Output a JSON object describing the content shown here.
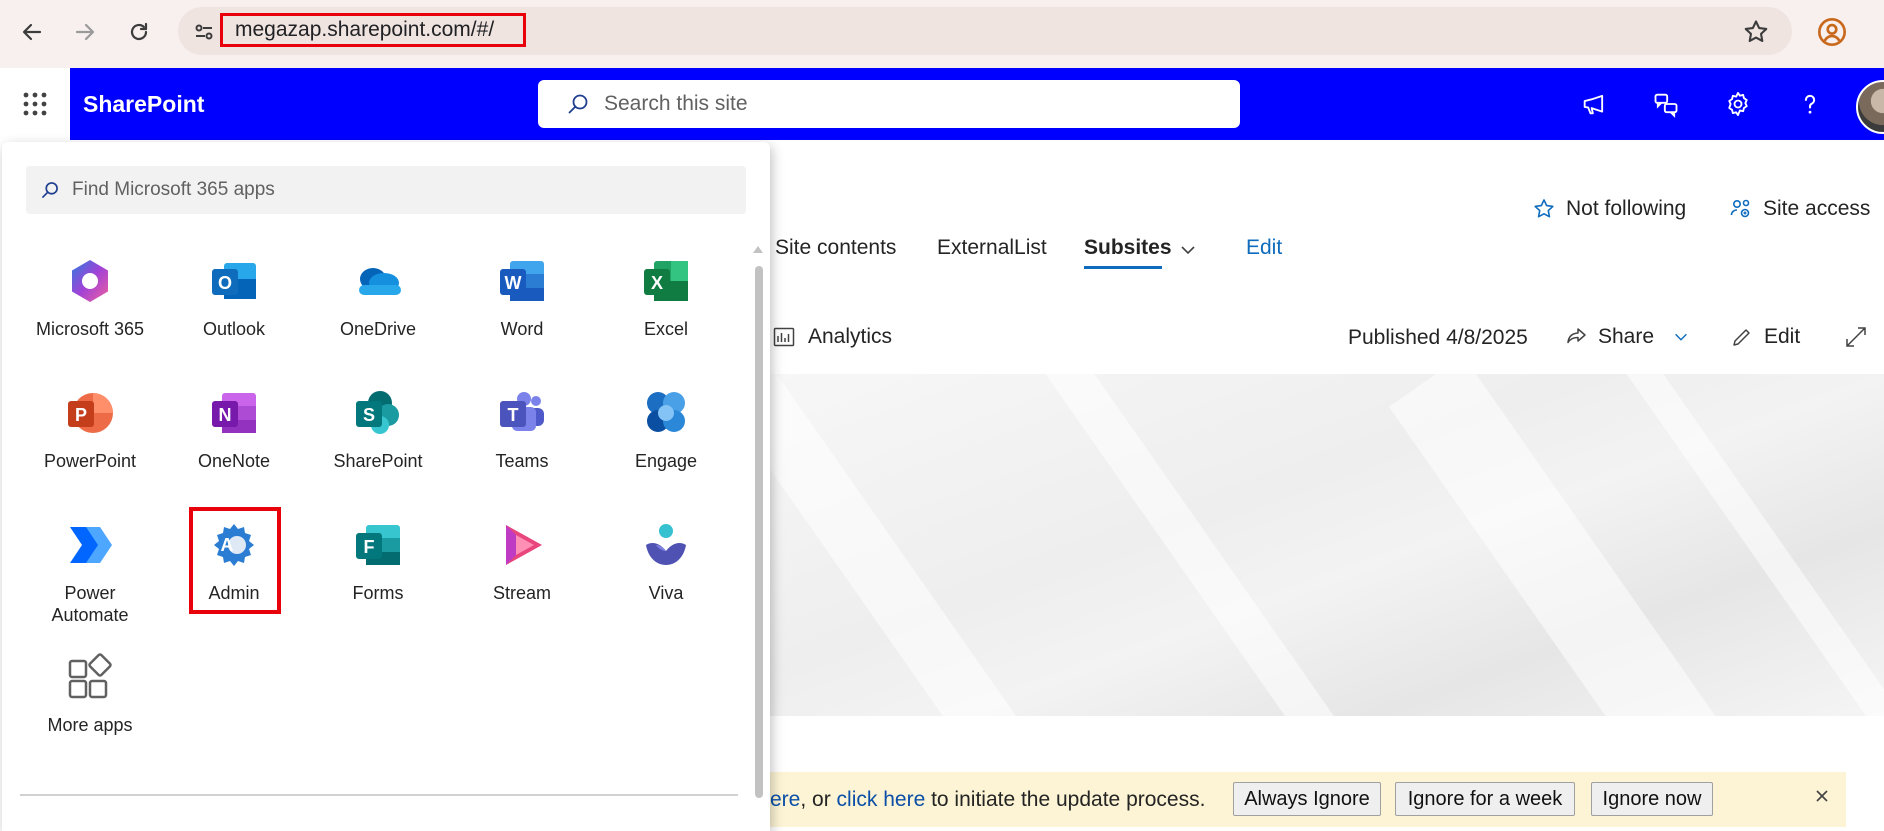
{
  "browser": {
    "url": "megazap.sharepoint.com/#/",
    "icons": [
      "back-arrow-icon",
      "forward-arrow-icon",
      "reload-icon",
      "site-settings-icon",
      "star-icon",
      "profile-icon"
    ]
  },
  "header": {
    "brand": "SharePoint",
    "search_placeholder": "Search this site",
    "icons": [
      "megaphone-icon",
      "chat-icon",
      "gear-icon",
      "help-icon"
    ]
  },
  "site": {
    "follow_label": "Not following",
    "site_access_label": "Site access",
    "nav": [
      {
        "label": "Site contents"
      },
      {
        "label": "ExternalList"
      },
      {
        "label": "Subsites"
      },
      {
        "label": "Edit"
      }
    ],
    "toolbar": {
      "analytics": "Analytics",
      "published": "Published 4/8/2025",
      "share": "Share",
      "edit": "Edit"
    }
  },
  "notice": {
    "prefix_link": "ere",
    "middle": ", or ",
    "link": "click here",
    "suffix": " to initiate the update process.",
    "buttons": [
      "Always Ignore",
      "Ignore for a week",
      "Ignore now"
    ]
  },
  "launcher": {
    "search_placeholder": "Find Microsoft 365 apps",
    "apps": [
      {
        "label": "Microsoft 365"
      },
      {
        "label": "Outlook"
      },
      {
        "label": "OneDrive"
      },
      {
        "label": "Word"
      },
      {
        "label": "Excel"
      },
      {
        "label": "PowerPoint"
      },
      {
        "label": "OneNote"
      },
      {
        "label": "SharePoint"
      },
      {
        "label": "Teams"
      },
      {
        "label": "Engage"
      },
      {
        "label": "Power\nAutomate"
      },
      {
        "label": "Admin"
      },
      {
        "label": "Forms"
      },
      {
        "label": "Stream"
      },
      {
        "label": "Viva"
      },
      {
        "label": "More apps"
      }
    ]
  },
  "colors": {
    "suite_bar": "#0000ff",
    "highlight": "#e8000b",
    "link": "#0b4fa8",
    "notice_bg": "#fcf4d4"
  }
}
